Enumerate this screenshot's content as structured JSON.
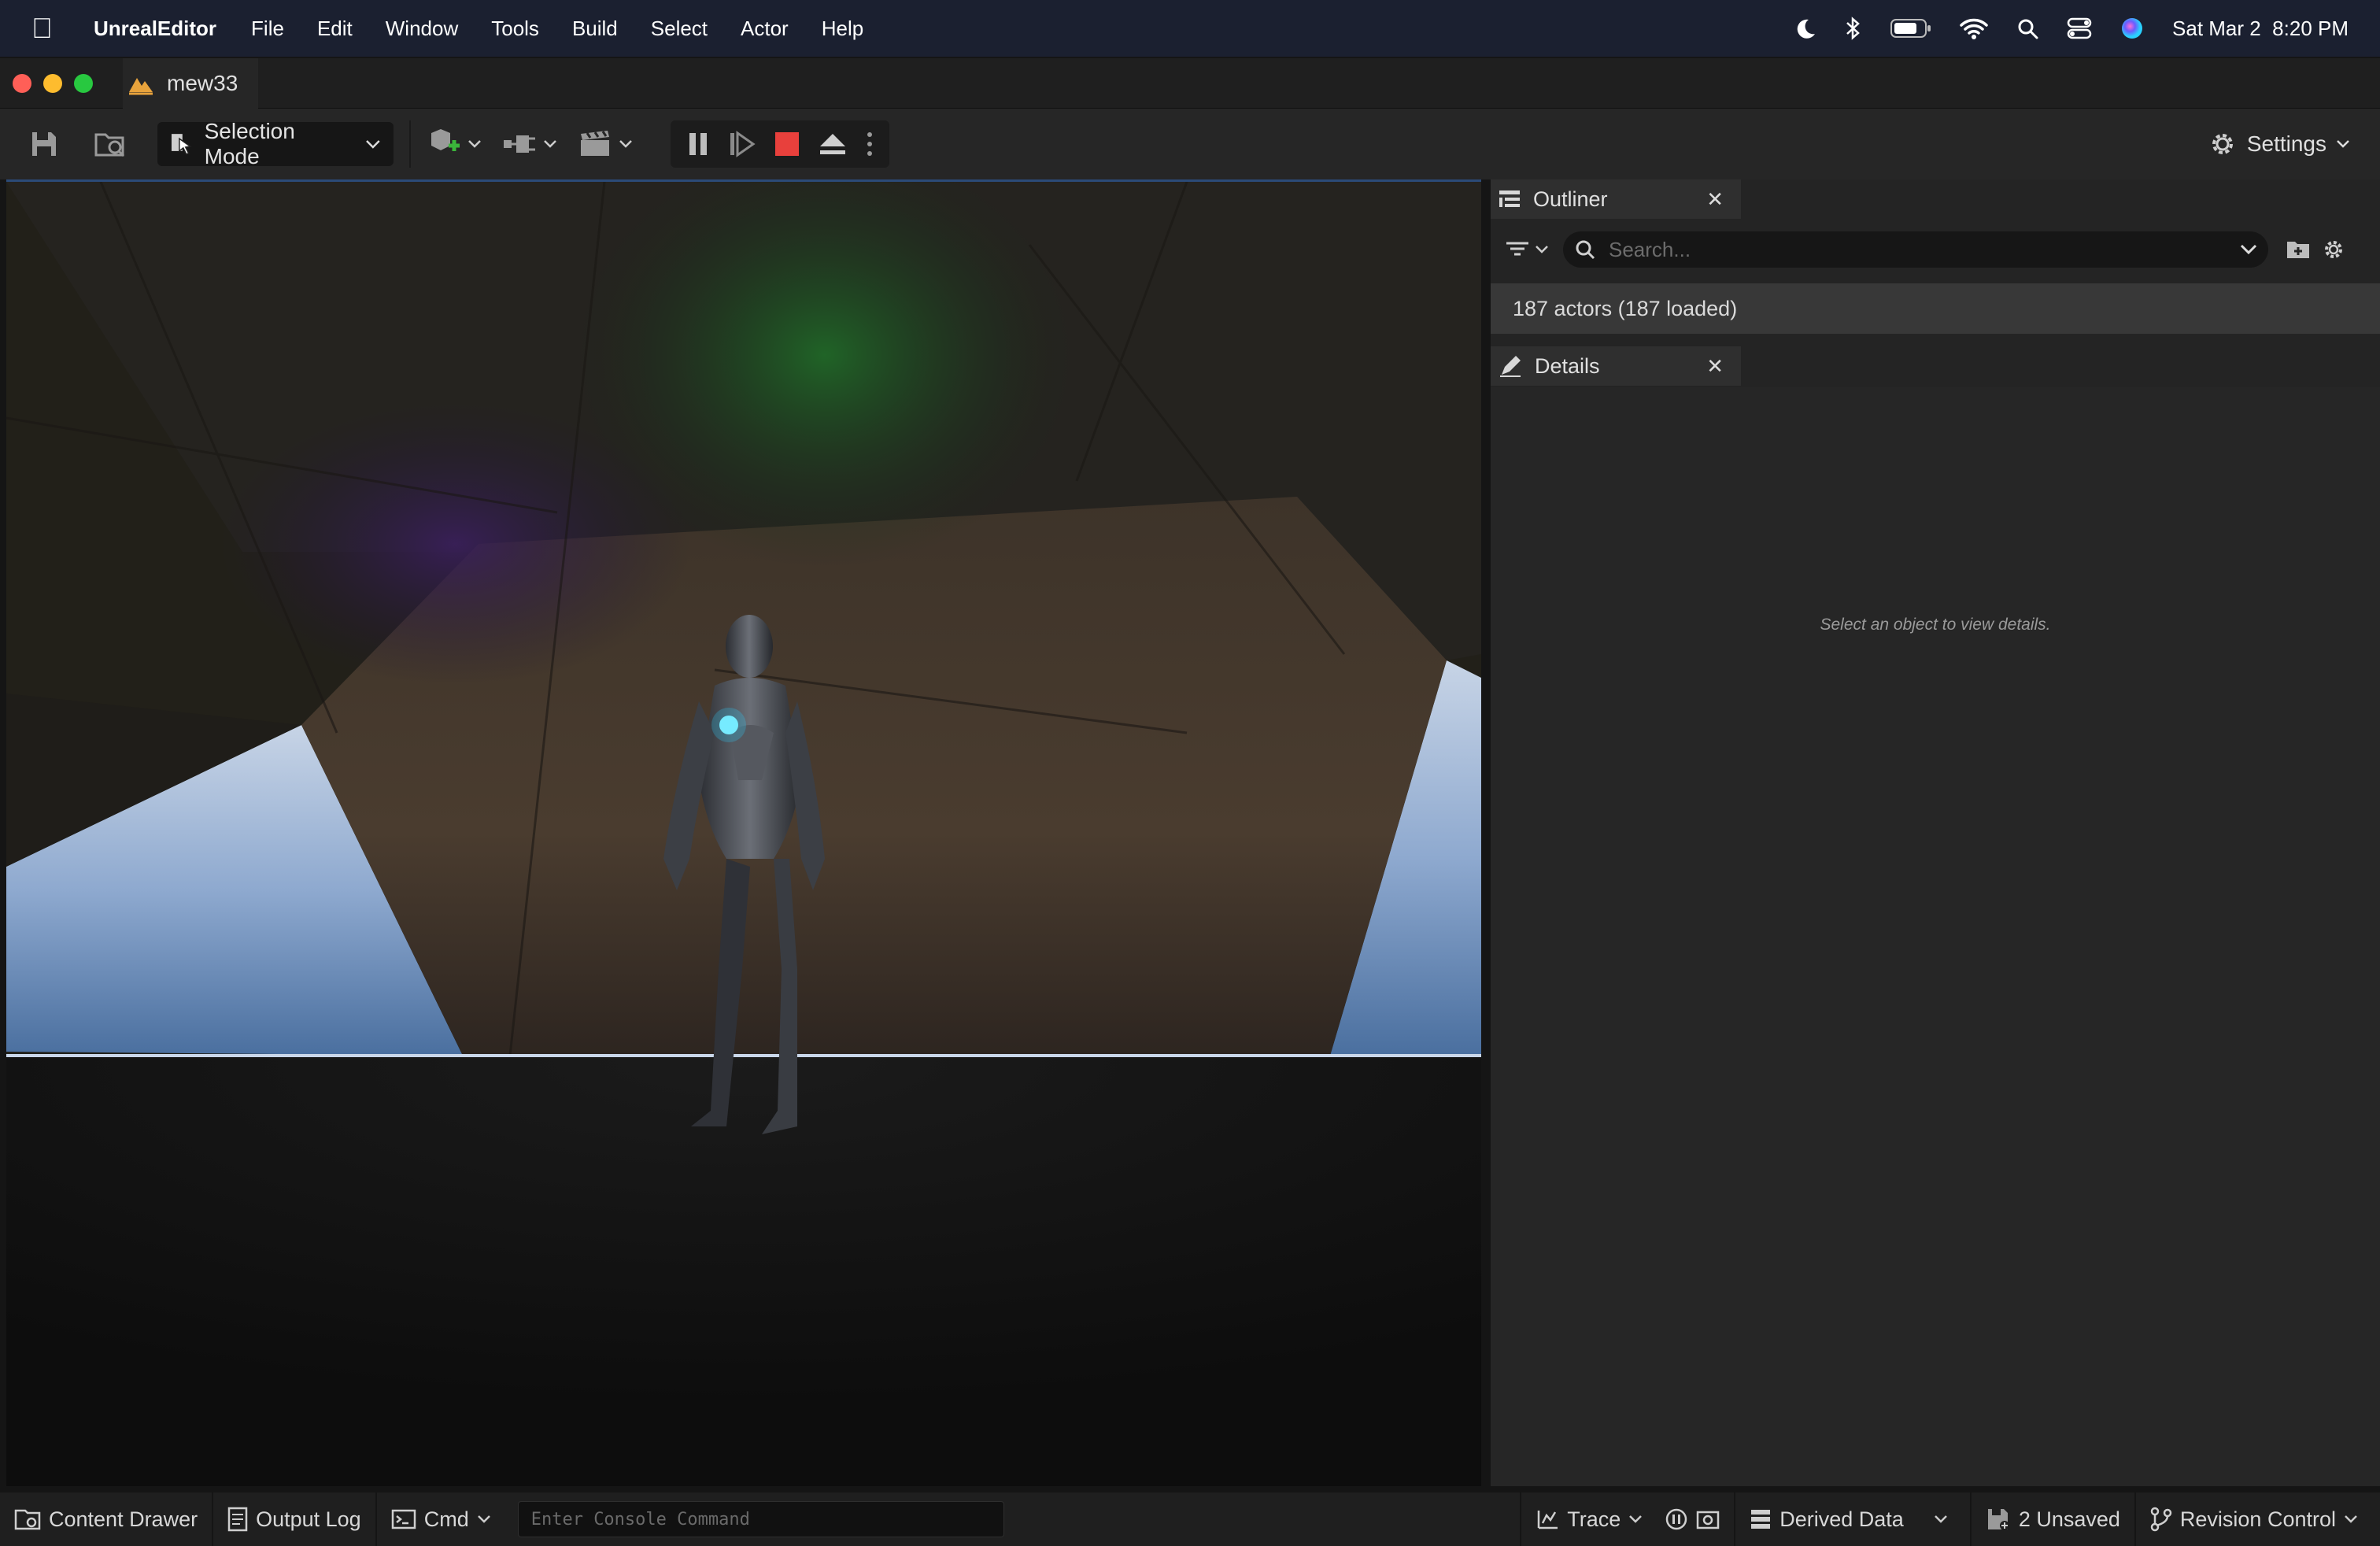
{
  "menubar": {
    "apple_icon": "apple-logo",
    "app_name": "UnrealEditor",
    "items": [
      "File",
      "Edit",
      "Window",
      "Tools",
      "Build",
      "Select",
      "Actor",
      "Help"
    ],
    "status_icons": [
      "moon-icon",
      "bluetooth-icon",
      "battery-icon",
      "wifi-icon",
      "spotlight-search-icon",
      "control-center-icon",
      "siri-icon"
    ],
    "datetime": "Sat Mar 2  8:20 PM"
  },
  "window": {
    "tab_title": "mew33"
  },
  "toolbar": {
    "selection_mode_label": "Selection Mode",
    "settings_label": "Settings",
    "icons": [
      "save-icon",
      "content-browse-icon",
      "add-actor-icon",
      "blueprint-icon",
      "cinematics-icon",
      "pause-icon",
      "skip-frame-icon",
      "stop-icon",
      "eject-icon",
      "more-options-icon"
    ],
    "colors": {
      "stop": "#e8403c"
    }
  },
  "outliner": {
    "tab_label": "Outliner",
    "search_placeholder": "Search...",
    "actor_count": "187 actors (187 loaded)"
  },
  "details": {
    "tab_label": "Details",
    "empty_message": "Select an object to view details."
  },
  "statusbar": {
    "content_drawer": "Content Drawer",
    "output_log": "Output Log",
    "cmd": "Cmd",
    "console_placeholder": "Enter Console Command",
    "trace": "Trace",
    "derived_data": "Derived Data",
    "unsaved": "2 Unsaved",
    "revision_control": "Revision Control"
  }
}
